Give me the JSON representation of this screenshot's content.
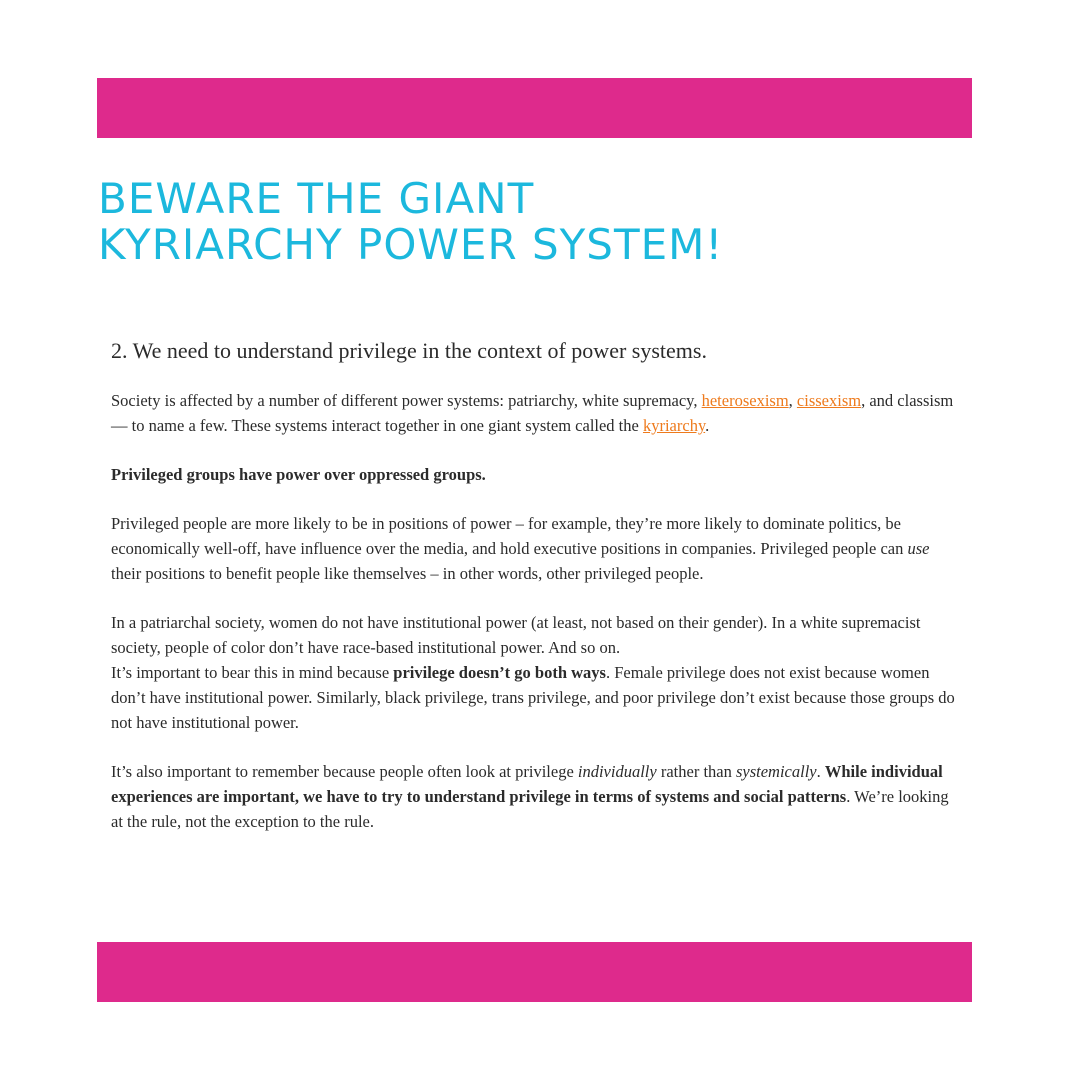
{
  "colors": {
    "banner": "#de2a8c",
    "title": "#1cb8dd",
    "link": "#ee7a1c",
    "text": "#2b2b2b"
  },
  "title": {
    "line1": "BEWARE THE GIANT",
    "line2": "KYRIARCHY POWER SYSTEM!"
  },
  "heading": "2. We need to understand privilege in the context of power systems.",
  "p1": {
    "t1": "Society is affected by a number of different power systems: patriarchy, white supremacy, ",
    "link1": "heterosexism",
    "t2": ", ",
    "link2": "cissexism",
    "t3": ", and classism — to name a few. These systems interact together in one giant system called the ",
    "link3": "kyriarchy",
    "t4": "."
  },
  "p2": "Privileged groups have power over oppressed groups.",
  "p3": {
    "t1": "Privileged people are more likely to be in positions of power – for example, they’re more likely to dominate politics, be economically well-off, have influence over the media, and hold executive positions in companies. Privileged people can ",
    "em": "use",
    "t2": " their positions to benefit people like themselves – in other words, other privileged people."
  },
  "p4": {
    "t1": "In a patriarchal society, women do not have institutional power (at least, not based on their gender). In a white supremacist society, people of color don’t have race-based institutional power. And so on.",
    "t2": "It’s important to bear this in mind because ",
    "bold": "privilege doesn’t go both ways",
    "t3": ". Female privilege does not exist because women don’t have institutional power. Similarly, black privilege, trans privilege, and poor privilege don’t exist because those groups do not have institutional power."
  },
  "p5": {
    "t1": "It’s also important to remember because people often look at privilege ",
    "em1": "individually",
    "t2": " rather than ",
    "em2": "systemically",
    "t3": ". ",
    "bold": "While individual experiences are important, we have to try to understand privilege in terms of systems and social patterns",
    "t4": ". We’re looking at the rule, not the exception to the rule."
  }
}
